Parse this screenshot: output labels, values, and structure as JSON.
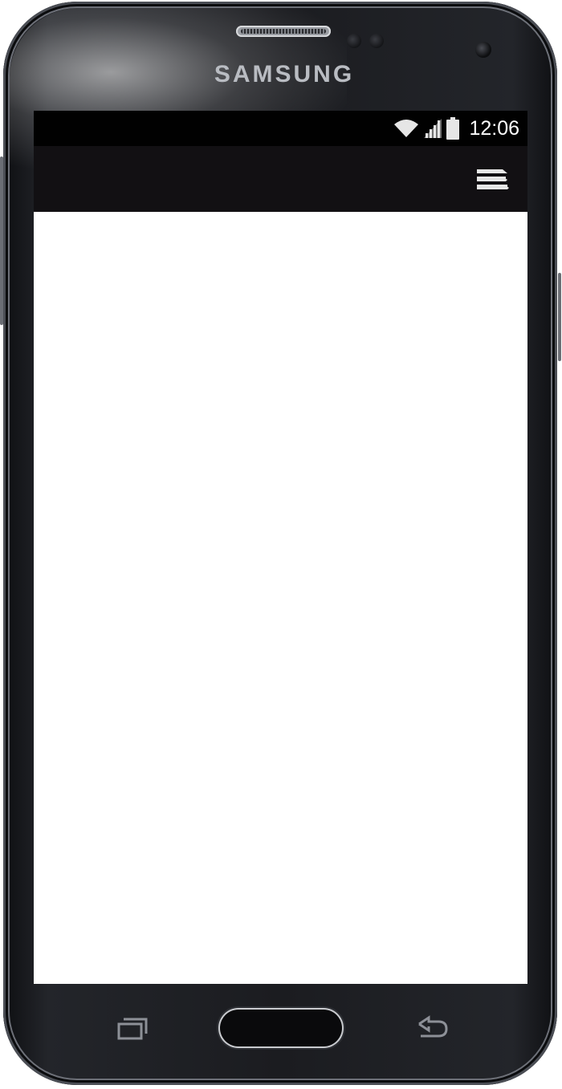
{
  "device": {
    "brand": "SAMSUNG"
  },
  "status_bar": {
    "time": "12:06",
    "icons": [
      "wifi-icon",
      "signal-icon",
      "battery-icon"
    ]
  },
  "action_bar": {
    "menu_icon": "overflow-menu-icon"
  },
  "nav_bar": {
    "buttons": [
      "recent-apps-icon",
      "home-button",
      "back-icon"
    ]
  },
  "colors": {
    "status_bar": "#010101",
    "action_bar": "#121013",
    "content": "#ffffff",
    "icon": "#e6e6e6"
  }
}
